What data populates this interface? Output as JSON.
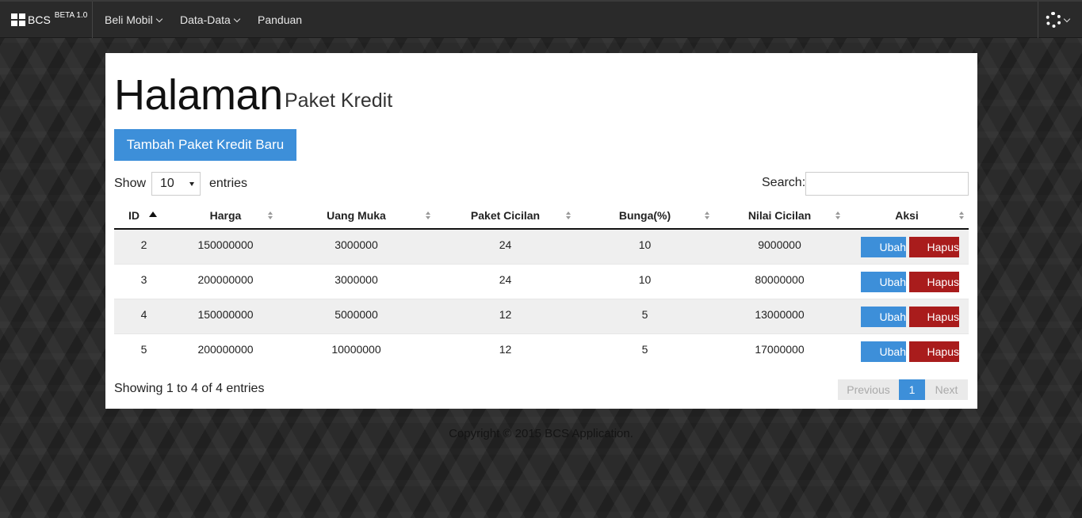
{
  "nav": {
    "brand": "BCS",
    "beta": "BETA 1.0",
    "menu": [
      {
        "label": "Beli Mobil"
      },
      {
        "label": "Data-Data"
      },
      {
        "label": "Panduan"
      }
    ],
    "settings_icon": "gear-icon"
  },
  "page": {
    "title": "Halaman",
    "subtitle": "Paket Kredit",
    "add_button": "Tambah Paket Kredit Baru"
  },
  "controls": {
    "show_label": "Show",
    "entries_value": "10",
    "entries_label": "entries",
    "search_label": "Search:",
    "search_value": ""
  },
  "table": {
    "columns": [
      "ID",
      "Harga",
      "Uang Muka",
      "Paket Cicilan",
      "Bunga(%)",
      "Nilai Cicilan",
      "Aksi"
    ],
    "rows": [
      [
        "2",
        "150000000",
        "3000000",
        "24",
        "10",
        "9000000"
      ],
      [
        "3",
        "200000000",
        "3000000",
        "24",
        "10",
        "80000000"
      ],
      [
        "4",
        "150000000",
        "5000000",
        "12",
        "5",
        "13000000"
      ],
      [
        "5",
        "200000000",
        "10000000",
        "12",
        "5",
        "17000000"
      ]
    ],
    "edit_label": "Ubah",
    "delete_label": "Hapus"
  },
  "footer_info": {
    "showing": "Showing 1 to 4 of 4 entries",
    "prev": "Previous",
    "current": "1",
    "next": "Next"
  },
  "copyright": "Copyright © 2015 BCS Application.",
  "colors": {
    "primary": "#3d8fd9",
    "danger": "#a91c1c",
    "navbar": "#2a2a2a"
  }
}
